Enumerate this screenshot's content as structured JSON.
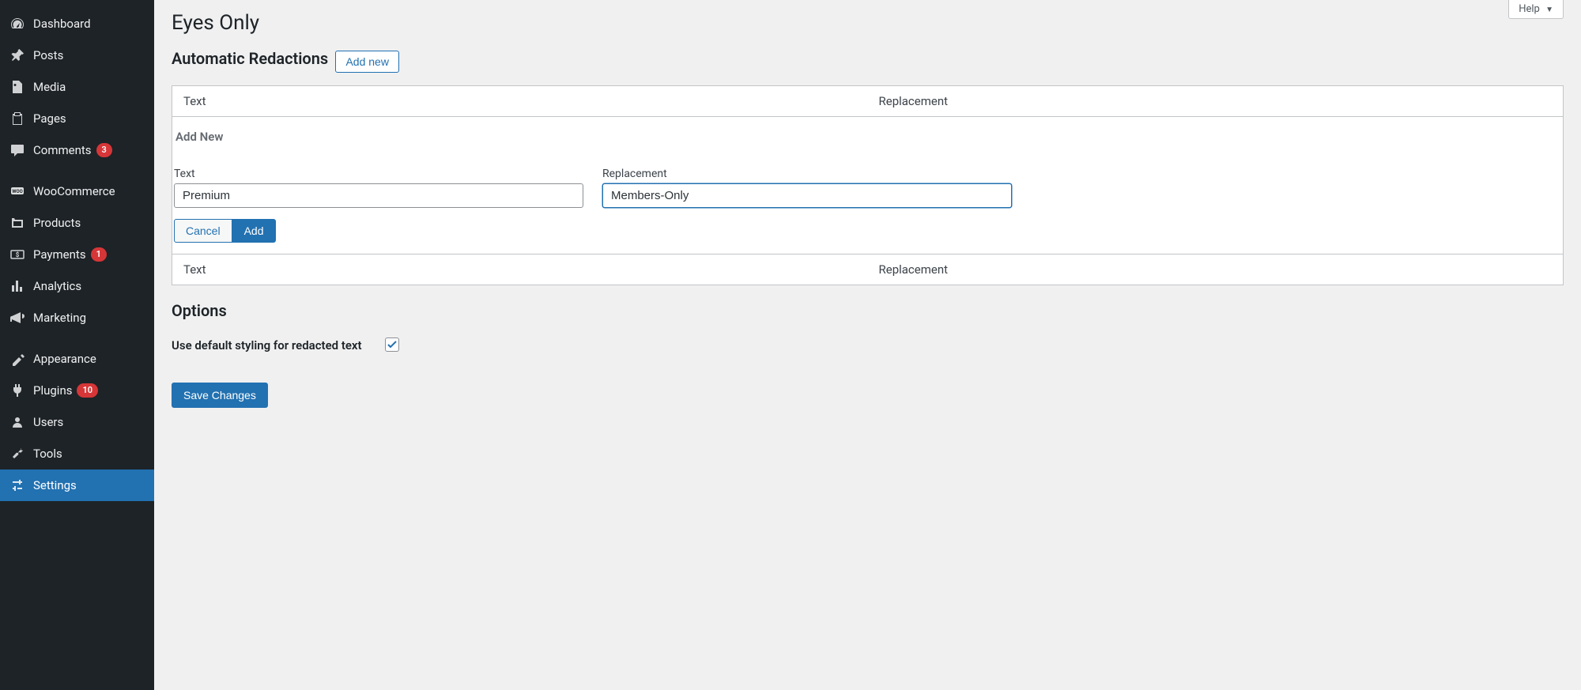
{
  "sidebar": {
    "items": [
      {
        "label": "Dashboard",
        "icon": "dashboard"
      },
      {
        "label": "Posts",
        "icon": "pin"
      },
      {
        "label": "Media",
        "icon": "media"
      },
      {
        "label": "Pages",
        "icon": "page"
      },
      {
        "label": "Comments",
        "icon": "comment",
        "badge": "3"
      },
      {
        "sep": true
      },
      {
        "label": "WooCommerce",
        "icon": "woo"
      },
      {
        "label": "Products",
        "icon": "products"
      },
      {
        "label": "Payments",
        "icon": "payments",
        "badge": "1"
      },
      {
        "label": "Analytics",
        "icon": "analytics"
      },
      {
        "label": "Marketing",
        "icon": "marketing"
      },
      {
        "sep": true
      },
      {
        "label": "Appearance",
        "icon": "appearance"
      },
      {
        "label": "Plugins",
        "icon": "plugins",
        "badge": "10"
      },
      {
        "label": "Users",
        "icon": "users"
      },
      {
        "label": "Tools",
        "icon": "tools"
      },
      {
        "label": "Settings",
        "icon": "settings",
        "active": true
      }
    ]
  },
  "help_label": "Help",
  "page_title": "Eyes Only",
  "redactions": {
    "heading": "Automatic Redactions",
    "add_new_btn": "Add new",
    "col_text": "Text",
    "col_replacement": "Replacement",
    "form": {
      "heading": "Add New",
      "text_label": "Text",
      "text_value": "Premium",
      "replacement_label": "Replacement",
      "replacement_value": "Members-Only",
      "cancel_label": "Cancel",
      "add_label": "Add"
    }
  },
  "options": {
    "heading": "Options",
    "default_styling_label": "Use default styling for redacted text",
    "default_styling_checked": true
  },
  "save_button": "Save Changes"
}
